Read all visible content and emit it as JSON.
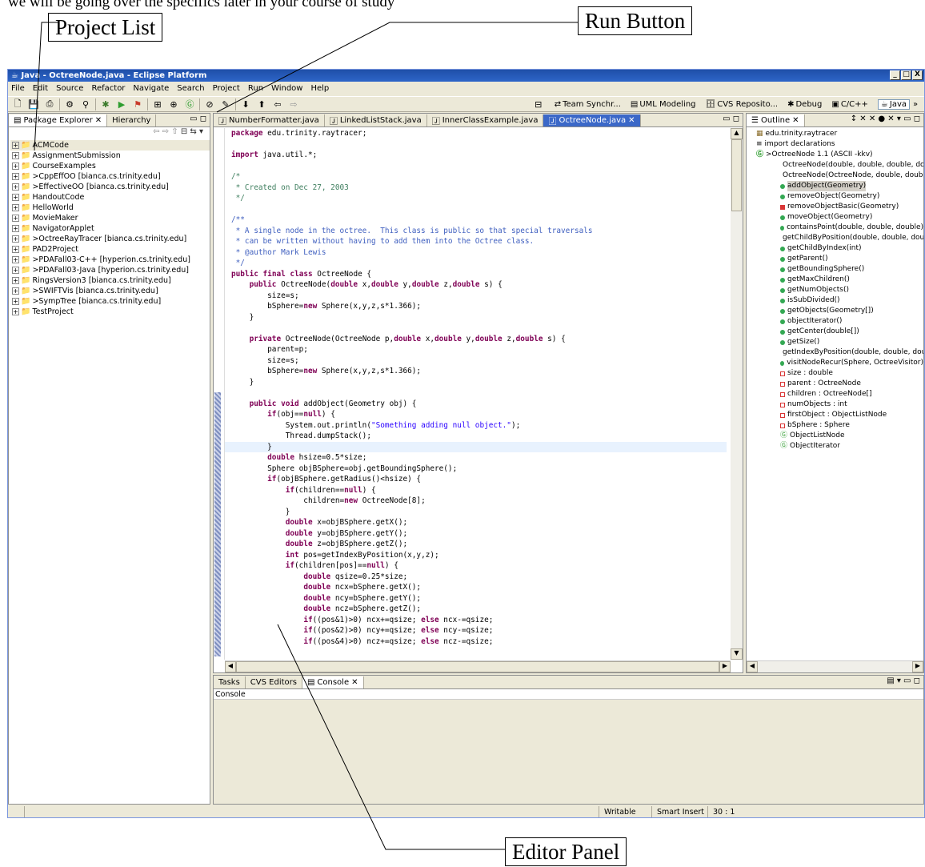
{
  "callouts": {
    "project_list": "Project List",
    "run_button": "Run Button",
    "editor_panel": "Editor Panel"
  },
  "top_partial_text": "we will be going over the specifics later in your course of study",
  "window": {
    "title": "Java - OctreeNode.java - Eclipse Platform",
    "controls": [
      "_",
      "□",
      "X"
    ]
  },
  "menu": [
    "File",
    "Edit",
    "Source",
    "Refactor",
    "Navigate",
    "Search",
    "Project",
    "Run",
    "Window",
    "Help"
  ],
  "perspectives": [
    "Team Synchr...",
    "UML Modeling",
    "CVS Reposito...",
    "Debug",
    "C/C++",
    "Java"
  ],
  "package_explorer": {
    "tabs": [
      "Package Explorer",
      "Hierarchy"
    ],
    "projects": [
      "ACMCode",
      "AssignmentSubmission",
      "CourseExamples",
      ">CppEffOO  [bianca.cs.trinity.edu]",
      ">EffectiveOO  [bianca.cs.trinity.edu]",
      "HandoutCode",
      "HelloWorld",
      "MovieMaker",
      "NavigatorApplet",
      ">OctreeRayTracer  [bianca.cs.trinity.edu]",
      "PAD2Project",
      ">PDAFall03-C++  [hyperion.cs.trinity.edu]",
      ">PDAFall03-Java  [hyperion.cs.trinity.edu]",
      "RingsVersion3  [bianca.cs.trinity.edu]",
      ">SWIFTVis  [bianca.cs.trinity.edu]",
      ">SympTree  [bianca.cs.trinity.edu]",
      "TestProject"
    ]
  },
  "editor": {
    "tabs": [
      "NumberFormatter.java",
      "LinkedListStack.java",
      "InnerClassExample.java",
      "OctreeNode.java"
    ],
    "code": [
      {
        "t": "package edu.trinity.raytracer;",
        "c": "kwline",
        "kw": "package"
      },
      {
        "t": "",
        "c": ""
      },
      {
        "t": "import java.util.*;",
        "c": "kwline",
        "kw": "import"
      },
      {
        "t": "",
        "c": ""
      },
      {
        "t": "/*",
        "c": "cm"
      },
      {
        "t": " * Created on Dec 27, 2003",
        "c": "cm"
      },
      {
        "t": " */",
        "c": "cm"
      },
      {
        "t": "",
        "c": ""
      },
      {
        "t": "/**",
        "c": "jd"
      },
      {
        "t": " * A single node in the octree.  This class is public so that special traversals",
        "c": "jd"
      },
      {
        "t": " * can be written without having to add them into the Octree class.",
        "c": "jd"
      },
      {
        "t": " * @author Mark Lewis",
        "c": "jd"
      },
      {
        "t": " */",
        "c": "jd"
      },
      {
        "t": "public final class OctreeNode {",
        "c": "plain"
      },
      {
        "t": "    public OctreeNode(double x,double y,double z,double s) {",
        "c": "plain"
      },
      {
        "t": "        size=s;",
        "c": "plain"
      },
      {
        "t": "        bSphere=new Sphere(x,y,z,s*1.366);",
        "c": "plain"
      },
      {
        "t": "    }",
        "c": "plain"
      },
      {
        "t": "",
        "c": ""
      },
      {
        "t": "    private OctreeNode(OctreeNode p,double x,double y,double z,double s) {",
        "c": "plain"
      },
      {
        "t": "        parent=p;",
        "c": "plain"
      },
      {
        "t": "        size=s;",
        "c": "plain"
      },
      {
        "t": "        bSphere=new Sphere(x,y,z,s*1.366);",
        "c": "plain"
      },
      {
        "t": "    }",
        "c": "plain"
      },
      {
        "t": "",
        "c": ""
      },
      {
        "t": "    public void addObject(Geometry obj) {",
        "c": "plain"
      },
      {
        "t": "        if(obj==null) {",
        "c": "plain"
      },
      {
        "t": "            System.out.println(\"Something adding null object.\");",
        "c": "plain"
      },
      {
        "t": "            Thread.dumpStack();",
        "c": "plain"
      },
      {
        "t": "        }",
        "c": "hl"
      },
      {
        "t": "        double hsize=0.5*size;",
        "c": "plain"
      },
      {
        "t": "        Sphere objBSphere=obj.getBoundingSphere();",
        "c": "plain"
      },
      {
        "t": "        if(objBSphere.getRadius()<hsize) {",
        "c": "plain"
      },
      {
        "t": "            if(children==null) {",
        "c": "plain"
      },
      {
        "t": "                children=new OctreeNode[8];",
        "c": "plain"
      },
      {
        "t": "            }",
        "c": "plain"
      },
      {
        "t": "            double x=objBSphere.getX();",
        "c": "plain"
      },
      {
        "t": "            double y=objBSphere.getY();",
        "c": "plain"
      },
      {
        "t": "            double z=objBSphere.getZ();",
        "c": "plain"
      },
      {
        "t": "            int pos=getIndexByPosition(x,y,z);",
        "c": "plain"
      },
      {
        "t": "            if(children[pos]==null) {",
        "c": "plain"
      },
      {
        "t": "                double qsize=0.25*size;",
        "c": "plain"
      },
      {
        "t": "                double ncx=bSphere.getX();",
        "c": "plain"
      },
      {
        "t": "                double ncy=bSphere.getY();",
        "c": "plain"
      },
      {
        "t": "                double ncz=bSphere.getZ();",
        "c": "plain"
      },
      {
        "t": "                if((pos&1)>0) ncx+=qsize; else ncx-=qsize;",
        "c": "plain"
      },
      {
        "t": "                if((pos&2)>0) ncy+=qsize; else ncy-=qsize;",
        "c": "plain"
      },
      {
        "t": "                if((pos&4)>0) ncz+=qsize; else ncz-=qsize;",
        "c": "plain"
      }
    ]
  },
  "outline": {
    "tab": "Outline",
    "items": [
      {
        "label": "edu.trinity.raytracer",
        "kind": "pkg",
        "indent": 1
      },
      {
        "label": "import declarations",
        "kind": "imp",
        "indent": 1
      },
      {
        "label": ">OctreeNode 1.1  (ASCII -kkv)",
        "kind": "cls",
        "indent": 1
      },
      {
        "label": "OctreeNode(double, double, double, double)",
        "kind": "g",
        "indent": 2
      },
      {
        "label": "OctreeNode(OctreeNode, double, double, double, double)",
        "kind": "r",
        "indent": 2
      },
      {
        "label": "addObject(Geometry)",
        "kind": "g",
        "indent": 2,
        "selected": true
      },
      {
        "label": "removeObject(Geometry)",
        "kind": "g",
        "indent": 2
      },
      {
        "label": "removeObjectBasic(Geometry)",
        "kind": "r",
        "indent": 2
      },
      {
        "label": "moveObject(Geometry)",
        "kind": "g",
        "indent": 2
      },
      {
        "label": "containsPoint(double, double, double)",
        "kind": "g",
        "indent": 2
      },
      {
        "label": "getChildByPosition(double, double, double)",
        "kind": "g",
        "indent": 2
      },
      {
        "label": "getChildByIndex(int)",
        "kind": "g",
        "indent": 2
      },
      {
        "label": "getParent()",
        "kind": "g",
        "indent": 2
      },
      {
        "label": "getBoundingSphere()",
        "kind": "g",
        "indent": 2
      },
      {
        "label": "getMaxChildren()",
        "kind": "g",
        "indent": 2
      },
      {
        "label": "getNumObjects()",
        "kind": "g",
        "indent": 2
      },
      {
        "label": "isSubDivided()",
        "kind": "g",
        "indent": 2
      },
      {
        "label": "getObjects(Geometry[])",
        "kind": "g",
        "indent": 2
      },
      {
        "label": "objectIterator()",
        "kind": "g",
        "indent": 2
      },
      {
        "label": "getCenter(double[])",
        "kind": "g",
        "indent": 2
      },
      {
        "label": "getSize()",
        "kind": "g",
        "indent": 2
      },
      {
        "label": "getIndexByPosition(double, double, double)",
        "kind": "r",
        "indent": 2
      },
      {
        "label": "visitNodeRecur(Sphere, OctreeVisitor)",
        "kind": "g",
        "indent": 2
      },
      {
        "label": "size : double",
        "kind": "o",
        "indent": 2
      },
      {
        "label": "parent : OctreeNode",
        "kind": "o",
        "indent": 2
      },
      {
        "label": "children : OctreeNode[]",
        "kind": "o",
        "indent": 2
      },
      {
        "label": "numObjects : int",
        "kind": "o",
        "indent": 2
      },
      {
        "label": "firstObject : ObjectListNode",
        "kind": "o",
        "indent": 2
      },
      {
        "label": "bSphere : Sphere",
        "kind": "o",
        "indent": 2
      },
      {
        "label": "ObjectListNode",
        "kind": "inner",
        "indent": 2
      },
      {
        "label": "ObjectIterator",
        "kind": "inner",
        "indent": 2
      }
    ]
  },
  "console": {
    "tabs": [
      "Tasks",
      "CVS Editors",
      "Console"
    ],
    "label": "Console"
  },
  "status": {
    "writable": "Writable",
    "insert_mode": "Smart Insert",
    "position": "30 : 1"
  },
  "colors": {
    "title_bar": "#2d65c8",
    "keyword": "#7f0055",
    "comment": "#3f7f5f",
    "javadoc": "#3f5fbf",
    "string": "#2a00ff",
    "highlight_line": "#e8f2fe"
  }
}
